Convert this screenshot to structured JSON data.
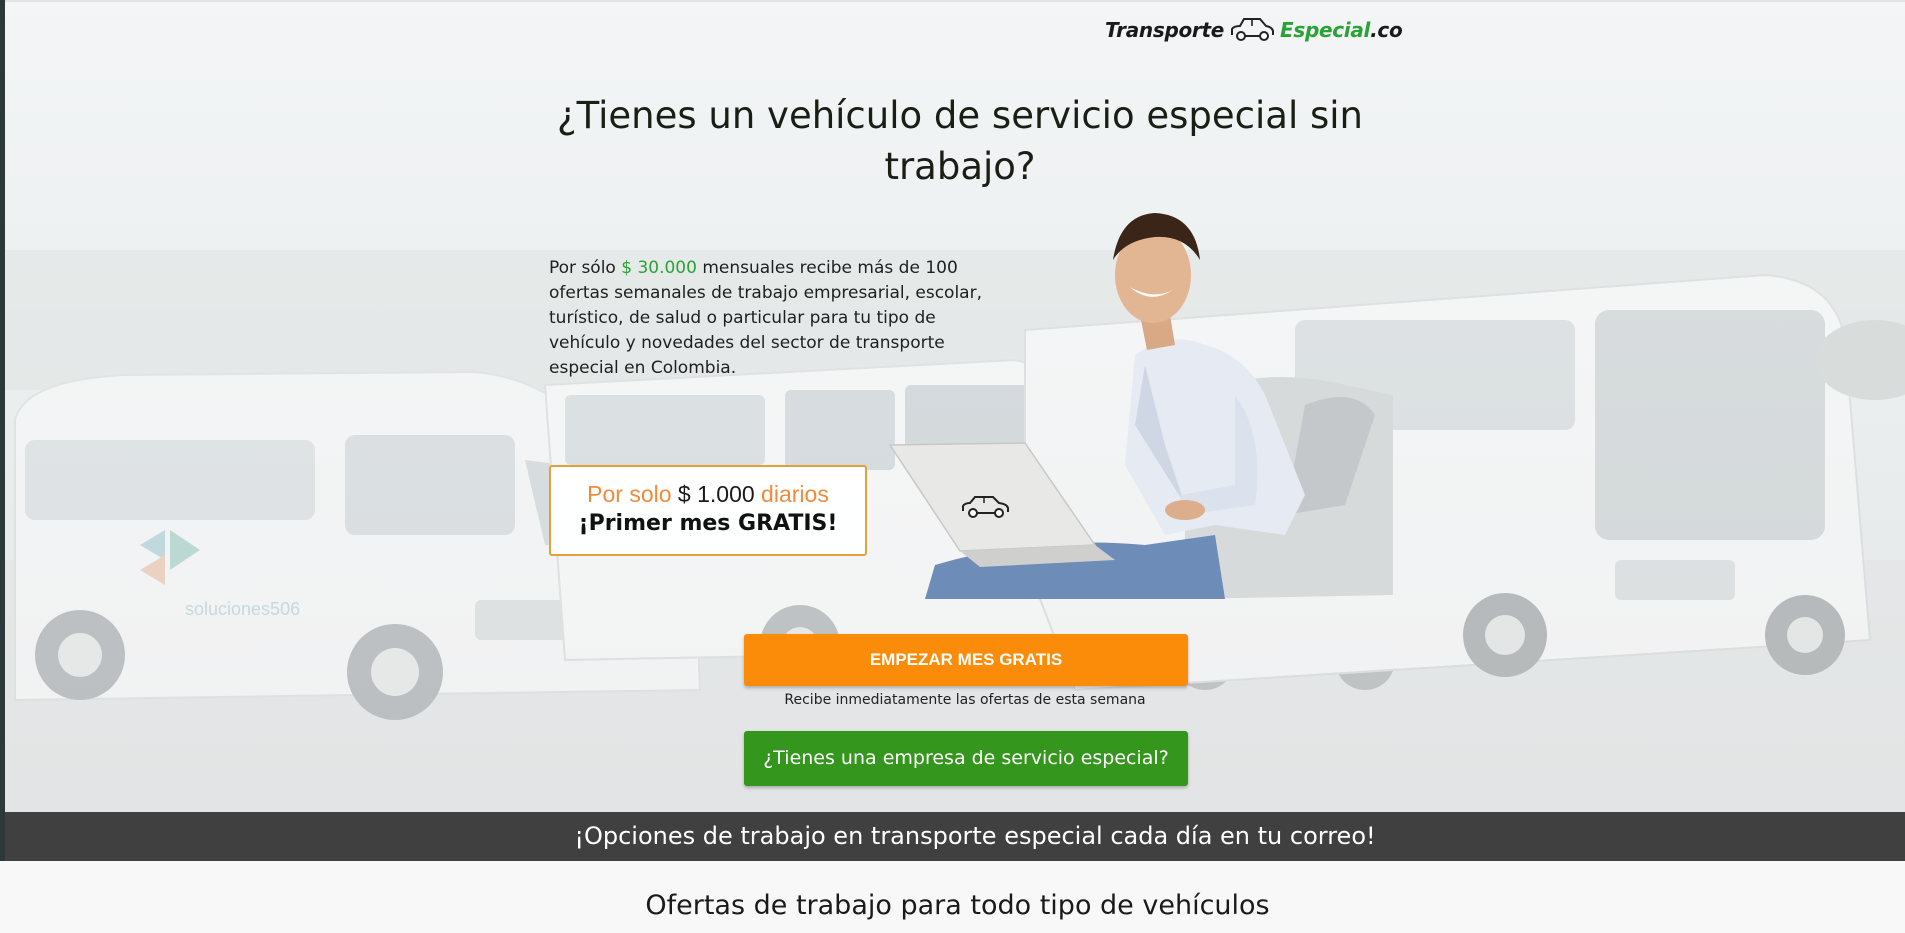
{
  "logo": {
    "part1": "Transporte",
    "part2": "Especial",
    "part3": ".co",
    "icon": "car-outline-icon"
  },
  "hero": {
    "headline": "¿Tienes un vehículo de servicio especial sin trabajo?",
    "intro_prefix": "Por sólo ",
    "intro_price": "$ 30.000",
    "intro_suffix": " mensuales recibe más de 100 ofertas semanales de trabajo empresarial, escolar, turístico, de salud o particular para tu tipo de vehículo y novedades del sector de transporte especial en Colombia.",
    "promo": {
      "prefix": "Por solo ",
      "amount": "$ 1.000",
      "suffix": " diarios",
      "headline": "¡Primer mes GRATIS!"
    },
    "laptop_icon": "car-outline-icon",
    "watermark": "soluciones506"
  },
  "actions": {
    "start_button": "EMPEZAR MES GRATIS",
    "start_note": "Recibe inmediatamente las ofertas de esta semana",
    "company_button": "¿Tienes una empresa de servicio especial?"
  },
  "band": {
    "text": "¡Opciones de trabajo en transporte especial cada día en tu correo!"
  },
  "section": {
    "title": "Ofertas de trabajo para todo tipo de vehículos"
  },
  "colors": {
    "orange": "#fb8c0a",
    "green": "#34961c",
    "brand_green": "#2aa236",
    "band": "#404040",
    "promo_border": "#e3a13b"
  }
}
